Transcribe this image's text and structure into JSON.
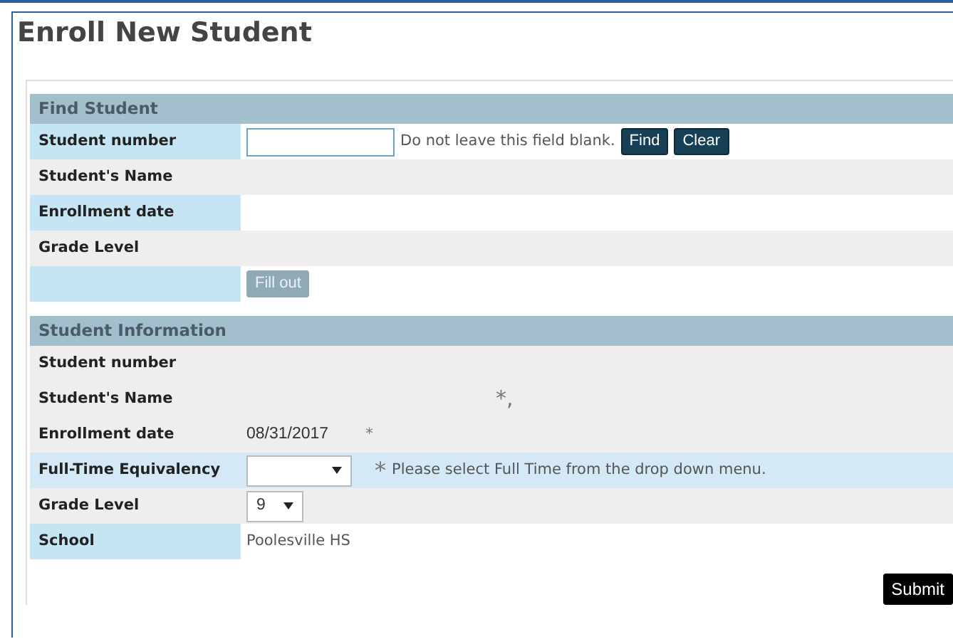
{
  "title": "Enroll New Student",
  "sections": [
    {
      "heading": "Find Student",
      "rows": [
        {
          "label": "Student number",
          "kind": "highlight",
          "items": [
            {
              "kind": "input",
              "value": ""
            },
            {
              "kind": "hint",
              "text": "Do not leave this field blank."
            },
            {
              "kind": "button",
              "text": "Find",
              "disabled": false
            },
            {
              "kind": "button",
              "text": "Clear",
              "disabled": false
            }
          ]
        },
        {
          "label": "Student's Name",
          "kind": "plain",
          "items": []
        },
        {
          "label": "Enrollment date",
          "kind": "highlight",
          "items": []
        },
        {
          "label": "Grade Level",
          "kind": "plain",
          "items": []
        },
        {
          "label": "",
          "kind": "highlight",
          "items": [
            {
              "kind": "button",
              "text": "Fill out",
              "disabled": true
            }
          ]
        }
      ]
    },
    {
      "heading": "Student Information",
      "rows": [
        {
          "label": "Student number",
          "kind": "plain",
          "items": []
        },
        {
          "label": "Student's Name",
          "kind": "plain",
          "items": [
            {
              "kind": "far-mark",
              "text": "*,"
            }
          ]
        },
        {
          "label": "Enrollment date",
          "kind": "plain",
          "items": [
            {
              "kind": "value",
              "text": "08/31/2017"
            },
            {
              "kind": "mark",
              "text": "*"
            }
          ]
        },
        {
          "label": "Full-Time Equivalency",
          "kind": "accent",
          "items": [
            {
              "kind": "select",
              "value": ""
            },
            {
              "kind": "big-mark",
              "text": "*"
            },
            {
              "kind": "hint",
              "text": "Please select Full Time from the drop down menu."
            }
          ]
        },
        {
          "label": "Grade Level",
          "kind": "plain",
          "items": [
            {
              "kind": "short-select",
              "value": "9"
            }
          ]
        },
        {
          "label": "School",
          "kind": "highlight",
          "items": [
            {
              "kind": "hint",
              "text": "Poolesville HS"
            }
          ]
        }
      ]
    }
  ],
  "submit": "Submit"
}
